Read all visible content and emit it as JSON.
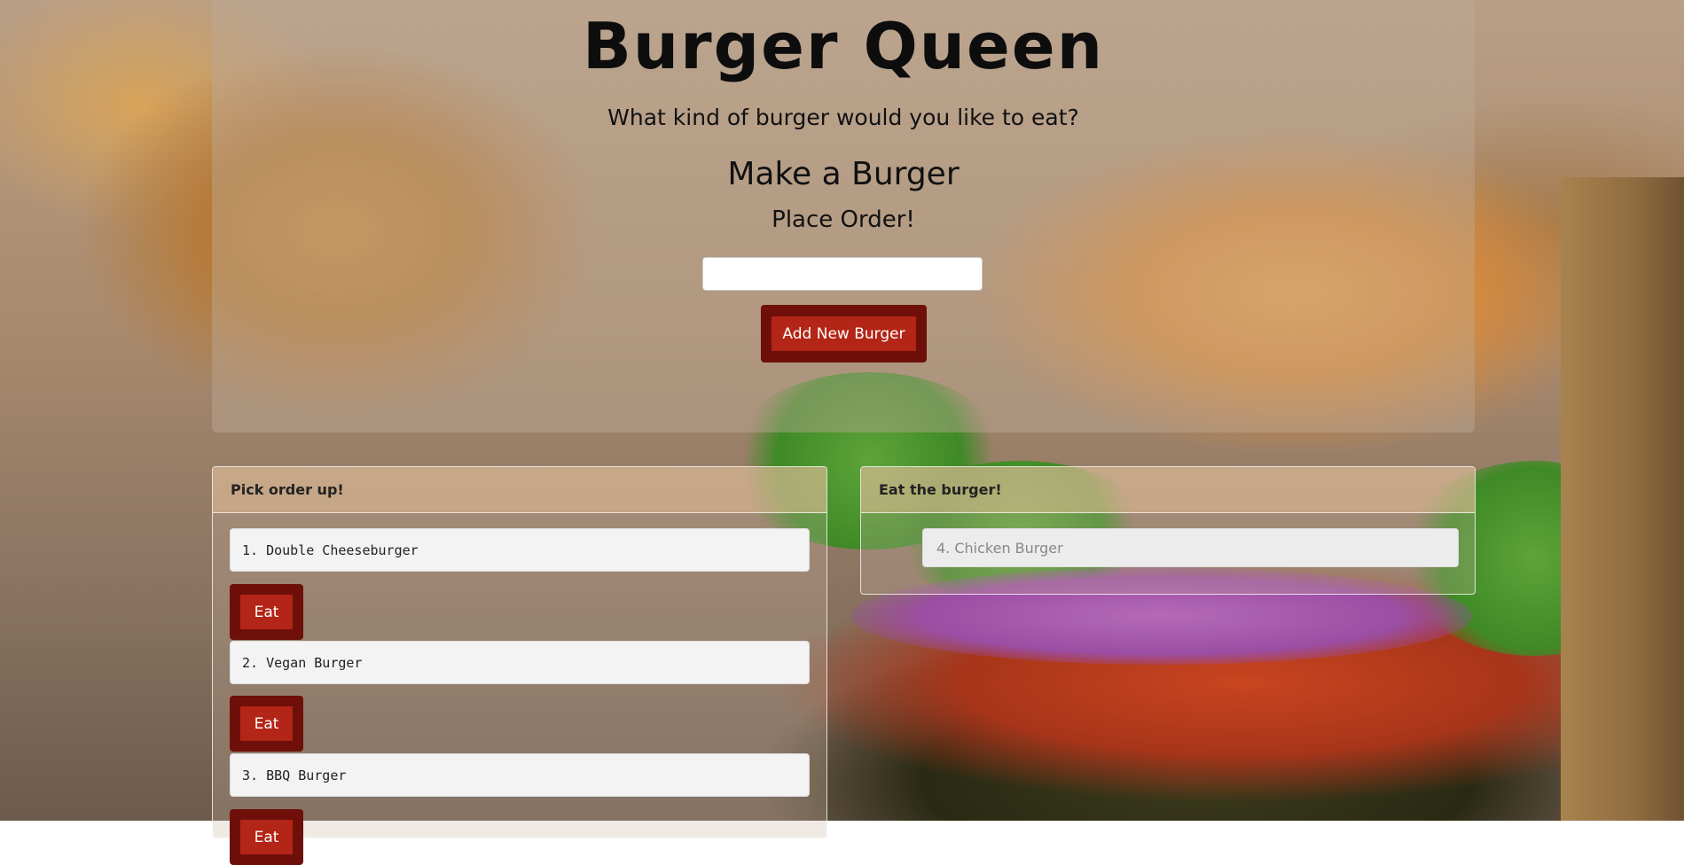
{
  "header": {
    "title": "Burger Queen",
    "subtitle": "What kind of burger would you like to eat?"
  },
  "order_form": {
    "heading": "Make a Burger",
    "subheading": "Place Order!",
    "input_value": "",
    "input_placeholder": "",
    "add_button_label": "Add New Burger"
  },
  "pick_up_panel": {
    "header": "Pick order up!",
    "items": [
      {
        "label": "1. Double Cheeseburger",
        "button": "Eat"
      },
      {
        "label": "2. Vegan Burger",
        "button": "Eat"
      },
      {
        "label": "3. BBQ Burger",
        "button": "Eat"
      }
    ]
  },
  "eaten_panel": {
    "header": "Eat the burger!",
    "items": [
      {
        "label": "4. Chicken Burger"
      }
    ]
  },
  "colors": {
    "button_outer": "#6e0f0a",
    "button_inner": "#b32516",
    "panel_overlay": "rgba(190,172,152,0.42)"
  }
}
